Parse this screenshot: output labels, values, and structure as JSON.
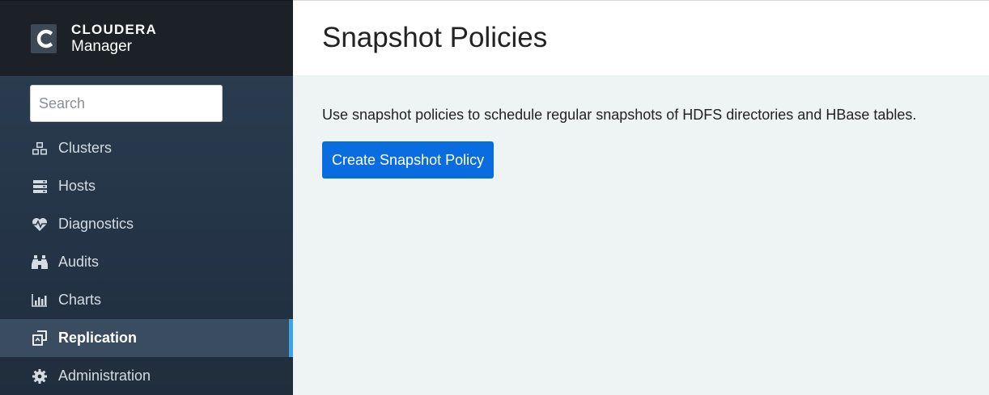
{
  "brand": {
    "name": "CLOUDERA",
    "product": "Manager"
  },
  "search": {
    "placeholder": "Search",
    "value": ""
  },
  "nav": {
    "items": [
      {
        "label": "Clusters",
        "icon": "cubes-icon"
      },
      {
        "label": "Hosts",
        "icon": "server-icon"
      },
      {
        "label": "Diagnostics",
        "icon": "heartbeat-icon"
      },
      {
        "label": "Audits",
        "icon": "binoculars-icon"
      },
      {
        "label": "Charts",
        "icon": "bar-chart-icon"
      },
      {
        "label": "Replication",
        "icon": "replication-icon",
        "active": true
      },
      {
        "label": "Administration",
        "icon": "gear-icon"
      }
    ]
  },
  "page": {
    "title": "Snapshot Policies",
    "description": "Use snapshot policies to schedule regular snapshots of HDFS directories and HBase tables.",
    "create_button": "Create Snapshot Policy"
  },
  "colors": {
    "accent": "#3ba7ea",
    "button": "#0a6ddf",
    "content_bg": "#eef3f4"
  }
}
